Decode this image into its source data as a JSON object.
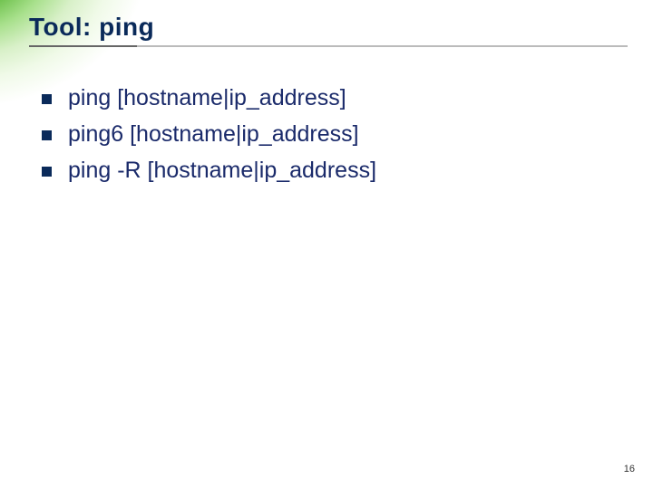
{
  "slide": {
    "title": "Tool:  ping",
    "bullets": [
      "ping [hostname|ip_address]",
      "ping6 [hostname|ip_address]",
      "ping -R [hostname|ip_address]"
    ],
    "page_number": "16"
  }
}
